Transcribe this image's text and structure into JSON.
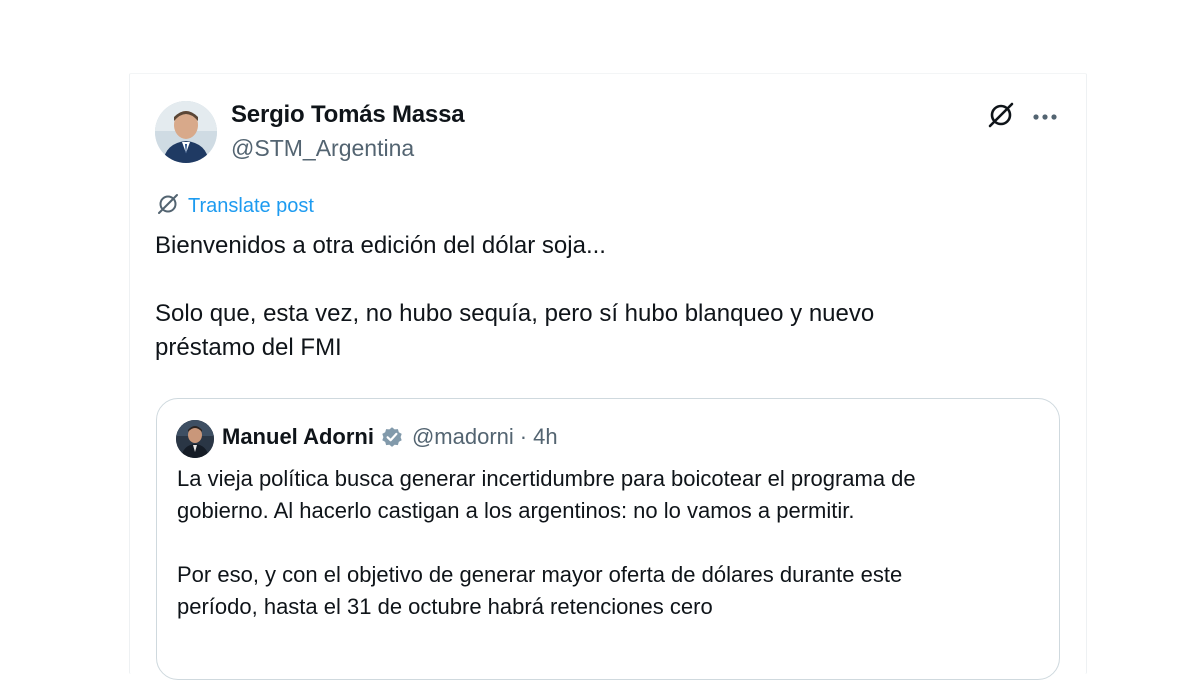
{
  "post": {
    "author_name": "Sergio Tomás Massa",
    "author_handle": "@STM_Argentina",
    "translate_label": "Translate post",
    "text": "Bienvenidos a otra edición del dólar soja...\n\nSolo que, esta vez, no hubo sequía, pero sí hubo blanqueo y nuevo\npréstamo del FMI"
  },
  "quoted_post": {
    "author_name": "Manuel Adorni",
    "author_handle": "@madorni",
    "separator": "·",
    "time": "4h",
    "text": "La vieja política busca generar incertidumbre para boicotear el programa de\ngobierno. Al hacerlo castigan a los argentinos: no lo vamos a permitir.\n\nPor eso, y con el objetivo de generar mayor oferta de dólares durante este\nperíodo, hasta el 31 de octubre habrá retenciones cero"
  },
  "icons": {
    "grok": "grok-icon",
    "more": "more-horizontal-icon",
    "translate": "translate-icon",
    "verified": "verified-badge-icon"
  },
  "colors": {
    "text_primary": "#0f1419",
    "text_secondary": "#536471",
    "link_blue": "#1d9bf0",
    "quote_border": "#cfd9de",
    "verified_gray": "#829aab"
  }
}
